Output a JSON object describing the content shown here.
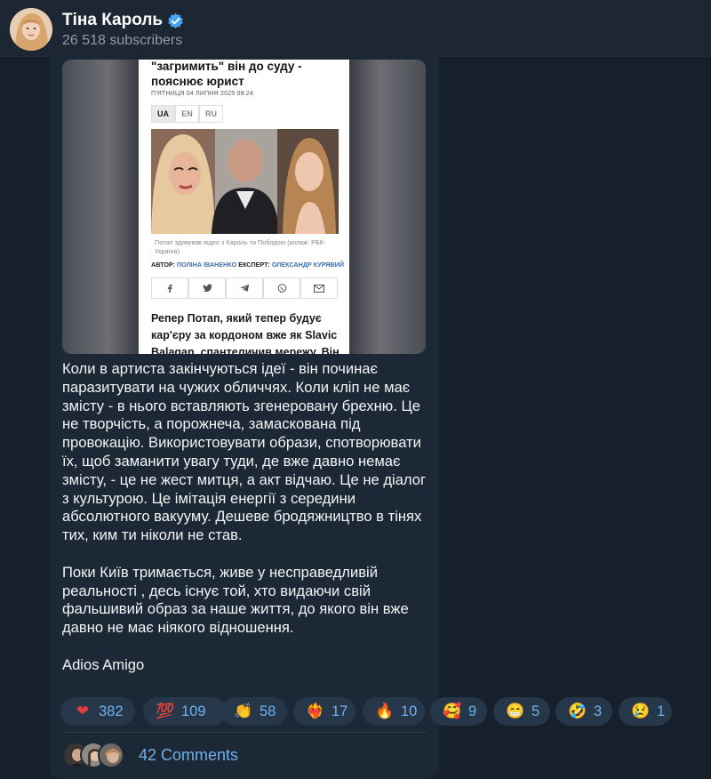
{
  "header": {
    "channel_name": "Тіна Кароль",
    "subscribers": "26 518 subscribers"
  },
  "article": {
    "title": "\"загримить\" він до суду - пояснює юрист",
    "date": "П'ЯТНИЦЯ 04 ЛИПНЯ 2025 08:24",
    "langs": [
      "UA",
      "EN",
      "RU"
    ],
    "caption": "Потап здивував відео з Кароль та Пободою (колаж: РБК-Україна)",
    "author_label": "АВТОР:",
    "author": "ПОЛІНА ІВАНЕНКО",
    "expert_label": "ЕКСПЕРТ:",
    "expert": "ОЛЕКСАНДР КУРЯВИЙ",
    "body": "Репер Потап, який тепер будує кар'єру за кордоном вже як Slavic Balagan, спантеличив мережу. Він опублікував"
  },
  "post": {
    "text": "Коли в артиста  закінчуються ідеї - він починає паразитувати на чужих обличчях. Коли кліп не має змісту - в нього вставляють згенеровану брехню. Це не творчість, а порожнеча, замаскована під провокацію. Використовувати образи, спотворювати їх, щоб заманити увагу туди, де вже давно немає змісту, - це не жест митця, а акт відчаю. Це не діалог з культурою. Це імітація енергії з середини абсолютного вакууму. Дешеве бродяжництво в тінях тих, ким ти ніколи не став.\n\nПоки Київ тримається, живе у несправедливій реальності , десь існує той, хто видаючи свій фальшивий образ за наше життя, до якого він вже давно не має ніякого відношення.\n\nAdios Amigo"
  },
  "reactions": [
    {
      "emoji": "❤",
      "icon": "red-heart-icon",
      "count": "382"
    },
    {
      "emoji": "💯",
      "icon": "hundred-points-icon",
      "count": "109"
    },
    {
      "emoji": "👏",
      "icon": "clapping-hands-icon",
      "count": "58"
    },
    {
      "emoji": "❤‍🔥",
      "icon": "heart-on-fire-icon",
      "count": "17"
    },
    {
      "emoji": "🔥",
      "icon": "fire-icon",
      "count": "10"
    },
    {
      "emoji": "🥰",
      "icon": "smiling-face-with-hearts-icon",
      "count": "9"
    },
    {
      "emoji": "😁",
      "icon": "beaming-face-icon",
      "count": "5"
    },
    {
      "emoji": "🤣",
      "icon": "rolling-laughing-icon",
      "count": "3"
    },
    {
      "emoji": "😢",
      "icon": "crying-face-icon",
      "count": "1"
    }
  ],
  "comments": {
    "label": "42 Comments"
  },
  "colors": {
    "background": "#16202b",
    "accent": "#6fb0ec",
    "reaction_bg": "#26374a"
  }
}
